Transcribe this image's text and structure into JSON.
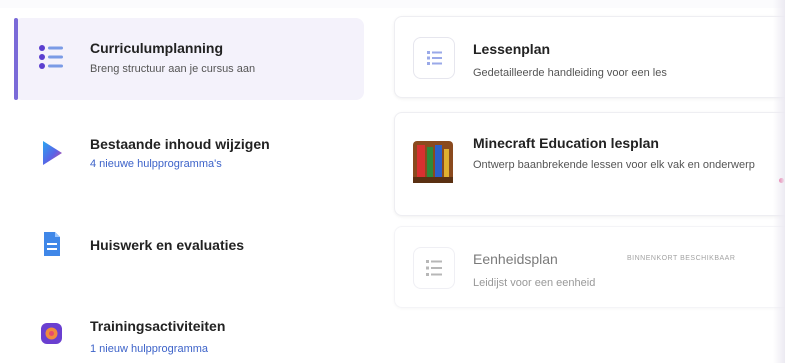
{
  "nav": {
    "items": [
      {
        "title": "Curriculumplanning",
        "subtitle": "Breng structuur aan je cursus aan",
        "icon": "list-icon"
      },
      {
        "title": "Bestaande inhoud wijzigen",
        "subtitle": "4 nieuwe hulpprogramma's",
        "icon": "play-shape-icon"
      },
      {
        "title": "Huiswerk en evaluaties",
        "subtitle": "",
        "icon": "document-icon"
      },
      {
        "title": "Trainingsactiviteiten",
        "subtitle": "1 nieuw hulpprogramma",
        "icon": "training-icon"
      }
    ]
  },
  "cards": [
    {
      "title": "Lessenplan",
      "description": "Gedetailleerde handleiding voor een les",
      "icon": "lesson-list-icon"
    },
    {
      "title": "Minecraft Education lesplan",
      "description": "Ontwerp baanbrekende lessen voor elk vak en onderwerp",
      "icon": "minecraft-icon"
    },
    {
      "title": "Eenheidsplan",
      "description": "Leidijst voor een eenheid",
      "badge": "BINNENKORT BESCHIKBAAR",
      "icon": "unit-list-icon"
    }
  ],
  "colors": {
    "accent": "#7a6ad8",
    "link": "#3d63c9"
  }
}
